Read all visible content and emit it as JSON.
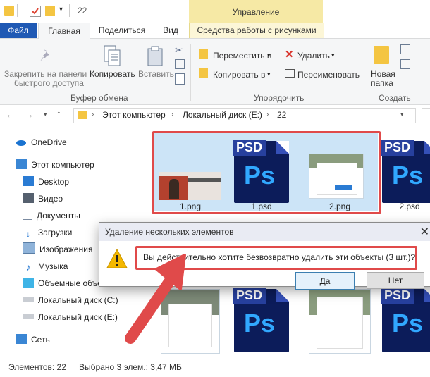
{
  "window": {
    "title": "22"
  },
  "ribbon_context": {
    "header": "Управление",
    "tab": "Средства работы с рисунками"
  },
  "tabs": [
    "Файл",
    "Главная",
    "Поделиться",
    "Вид"
  ],
  "ribbon": {
    "pin": [
      "Закрепить на панели",
      "быстрого доступа"
    ],
    "copy": "Копировать",
    "paste": "Вставить",
    "clipboard_group": "Буфер обмена",
    "move_to": "Переместить в",
    "copy_to": "Копировать в",
    "delete": "Удалить",
    "rename": "Переименовать",
    "organize_group": "Упорядочить",
    "new_folder": [
      "Новая",
      "папка"
    ],
    "create_group": "Создать"
  },
  "address": {
    "crumbs": [
      "Этот компьютер",
      "Локальный диск (E:)",
      "22"
    ]
  },
  "nav": {
    "onedrive": "OneDrive",
    "this_pc": "Этот компьютер",
    "items": [
      "Desktop",
      "Видео",
      "Документы",
      "Загрузки",
      "Изображения",
      "Музыка",
      "Объемные объе",
      "Локальный диск (C:)",
      "Локальный диск (E:)"
    ],
    "network": "Сеть"
  },
  "files": {
    "row1": [
      "1.png",
      "1.psd",
      "2.png",
      "2.psd"
    ],
    "psd_tag": "PSD",
    "ps_mark": "Ps"
  },
  "dialog": {
    "title": "Удаление нескольких элементов",
    "message": "Вы действительно хотите безвозвратно удалить эти объекты (3 шт.)?",
    "yes": "Да",
    "no": "Нет"
  },
  "status": {
    "count": "Элементов: 22",
    "selected": "Выбрано 3 элем.: 3,47 МБ"
  },
  "colors": {
    "accent": "#1f59b4",
    "highlight": "#e04a4a",
    "selection": "#cce4f7",
    "warning": "#f5b800"
  }
}
